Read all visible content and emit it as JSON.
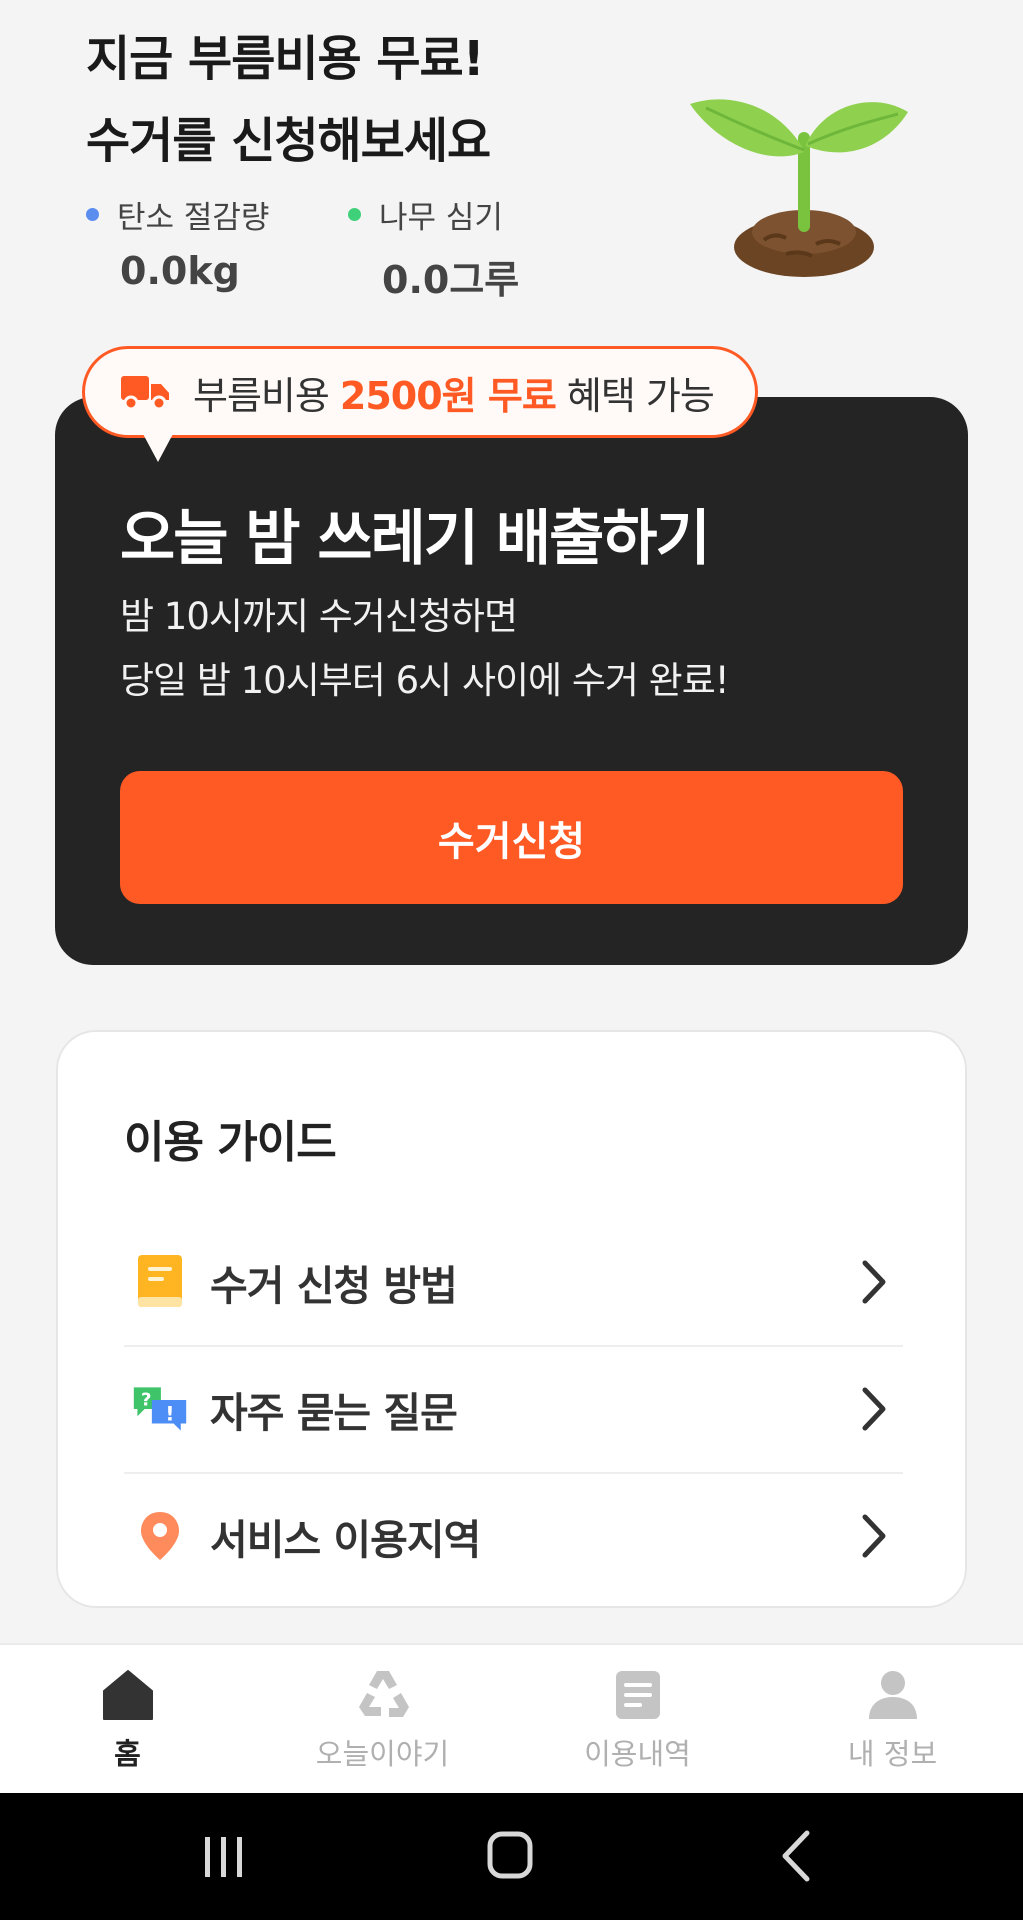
{
  "hero": {
    "title_line1": "지금 부름비용 무료!",
    "title_line2": "수거를 신청해보세요",
    "stats": [
      {
        "label": "탄소 절감량",
        "value": "0.0kg",
        "dot_color": "#5b8def"
      },
      {
        "label": "나무 심기",
        "value": "0.0그루",
        "dot_color": "#3fd07a"
      }
    ],
    "illustration": "sprout-icon"
  },
  "promo": {
    "prefix": "부름비용 ",
    "highlight": "2500원 무료",
    "suffix": " 혜택 가능",
    "icon": "truck-icon"
  },
  "collect_card": {
    "title": "오늘 밤 쓰레기 배출하기",
    "desc_line1": "밤 10시까지 수거신청하면",
    "desc_line2": "당일 밤 10시부터 6시 사이에 수거 완료!",
    "button_label": "수거신청"
  },
  "guide": {
    "title": "이용 가이드",
    "items": [
      {
        "label": "수거 신청 방법",
        "icon": "book-icon"
      },
      {
        "label": "자주 묻는 질문",
        "icon": "faq-chat-icon"
      },
      {
        "label": "서비스 이용지역",
        "icon": "location-pin-icon"
      }
    ]
  },
  "bottom_nav": {
    "items": [
      {
        "label": "홈",
        "icon": "home-icon",
        "active": true
      },
      {
        "label": "오늘이야기",
        "icon": "recycle-icon",
        "active": false
      },
      {
        "label": "이용내역",
        "icon": "document-icon",
        "active": false
      },
      {
        "label": "내 정보",
        "icon": "user-icon",
        "active": false
      }
    ]
  },
  "system_nav": {
    "buttons": [
      "recent-apps-icon",
      "home-circle-icon",
      "back-icon"
    ]
  },
  "colors": {
    "accent": "#ff5a24",
    "card_dark": "#252424",
    "background": "#f4f4f4"
  }
}
